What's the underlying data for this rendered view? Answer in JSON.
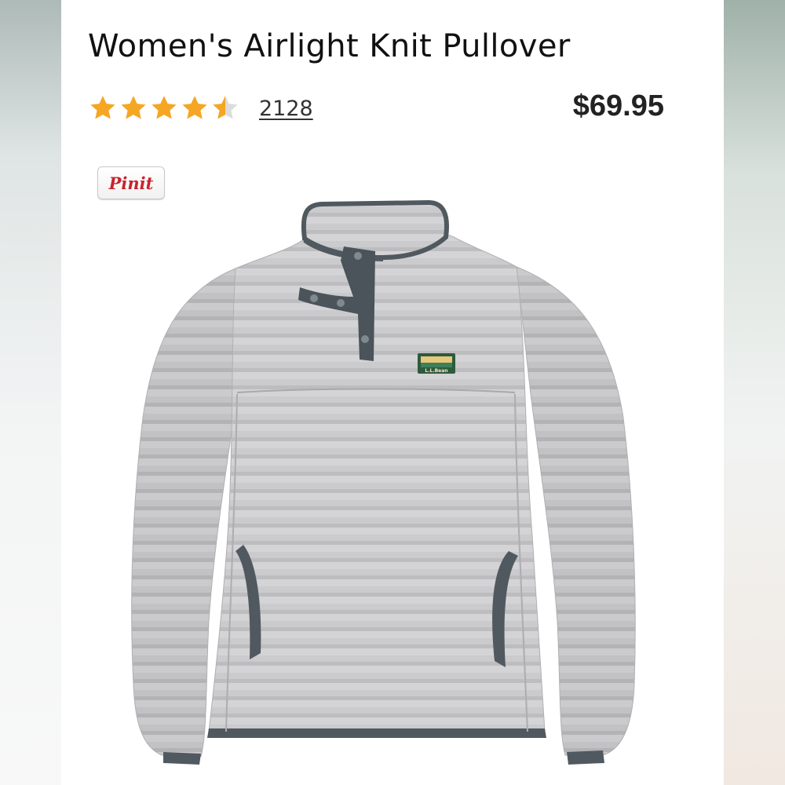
{
  "product": {
    "title": "Women's Airlight Knit Pullover",
    "rating": 4.5,
    "rating_max": 5,
    "review_count": "2128",
    "price": "$69.95",
    "pin_label": "Pinit",
    "image_icon": "gray-knit-pullover-image",
    "logo_label": "L.L.Bean"
  },
  "colors": {
    "star": "#f5a623",
    "price": "#222222",
    "pin": "#c8232c",
    "garment": "#c9c8cb",
    "trim": "#4c555b"
  }
}
